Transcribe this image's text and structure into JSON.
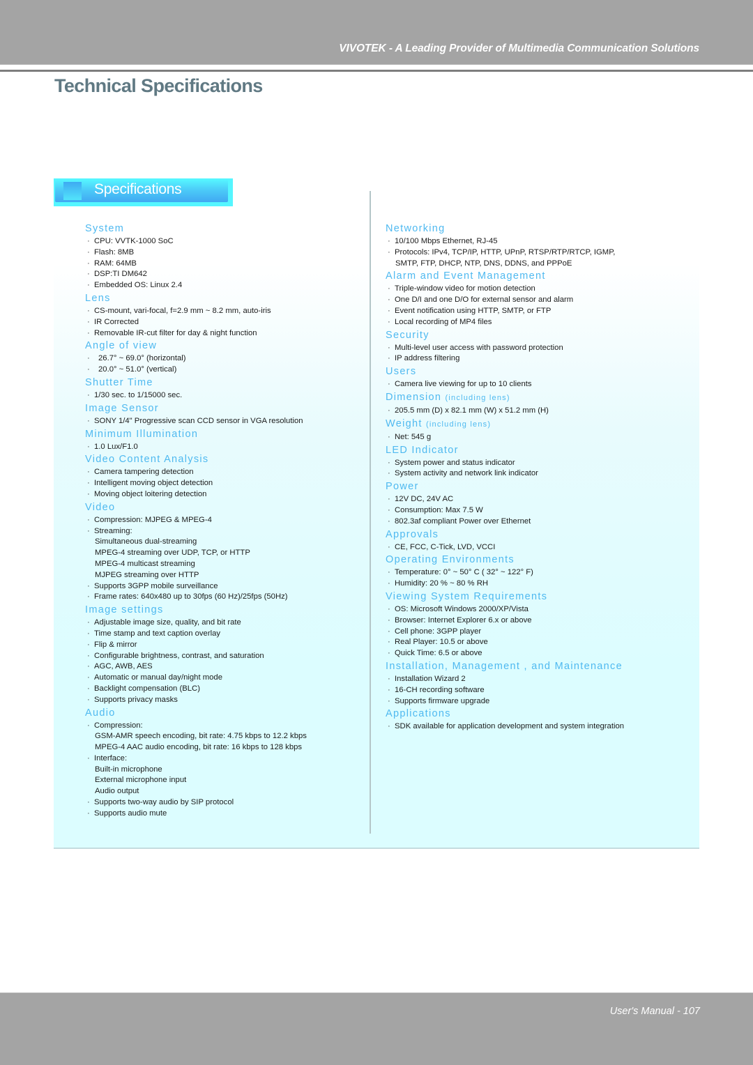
{
  "header": {
    "tagline": "VIVOTEK - A Leading Provider of Multimedia Communication Solutions"
  },
  "page_title": "Technical Specifications",
  "banner": {
    "label": "Specifications"
  },
  "left_column": [
    {
      "title": "System",
      "note": "",
      "items": [
        {
          "text": "CPU: VVTK-1000 SoC",
          "bullet": true
        },
        {
          "text": "Flash: 8MB",
          "bullet": true
        },
        {
          "text": "RAM: 64MB",
          "bullet": true
        },
        {
          "text": "DSP:TI DM642",
          "bullet": true
        },
        {
          "text": "Embedded OS: Linux 2.4",
          "bullet": true
        }
      ]
    },
    {
      "title": "Lens",
      "note": "",
      "items": [
        {
          "text": "CS-mount, vari-focal, f=2.9 mm ~ 8.2 mm, auto-iris",
          "bullet": true
        },
        {
          "text": "IR Corrected",
          "bullet": true
        },
        {
          "text": "Removable IR-cut filter for day & night function",
          "bullet": true
        }
      ]
    },
    {
      "title": "Angle of view",
      "note": "",
      "items": [
        {
          "text": "26.7° ~ 69.0° (horizontal)",
          "bullet": true,
          "wide": true
        },
        {
          "text": "20.0° ~ 51.0° (vertical)",
          "bullet": true,
          "wide": true
        }
      ]
    },
    {
      "title": "Shutter Time",
      "note": "",
      "items": [
        {
          "text": "1/30 sec. to 1/15000 sec.",
          "bullet": true
        }
      ]
    },
    {
      "title": "Image Sensor",
      "note": "",
      "items": [
        {
          "text": "SONY 1/4\" Progressive scan CCD sensor in VGA resolution",
          "bullet": true
        }
      ]
    },
    {
      "title": "Minimum Illumination",
      "note": "",
      "items": [
        {
          "text": "1.0 Lux/F1.0",
          "bullet": true
        }
      ]
    },
    {
      "title": "Video Content Analysis",
      "note": "",
      "items": [
        {
          "text": "Camera tampering detection",
          "bullet": true
        },
        {
          "text": "Intelligent moving object detection",
          "bullet": true
        },
        {
          "text": "Moving object loitering detection",
          "bullet": true
        }
      ]
    },
    {
      "title": "Video",
      "note": "",
      "items": [
        {
          "text": "Compression: MJPEG & MPEG-4",
          "bullet": true
        },
        {
          "text": "Streaming:",
          "bullet": true
        },
        {
          "text": "Simultaneous dual-streaming",
          "bullet": false
        },
        {
          "text": "MPEG-4 streaming over UDP, TCP, or HTTP",
          "bullet": false
        },
        {
          "text": "MPEG-4 multicast streaming",
          "bullet": false
        },
        {
          "text": "MJPEG streaming over HTTP",
          "bullet": false
        },
        {
          "text": "Supports 3GPP mobile surveillance",
          "bullet": true
        },
        {
          "text": "Frame rates: 640x480 up to 30fps (60 Hz)/25fps (50Hz)",
          "bullet": true
        }
      ]
    },
    {
      "title": "Image settings",
      "note": "",
      "items": [
        {
          "text": "Adjustable image size, quality, and bit rate",
          "bullet": true
        },
        {
          "text": "Time stamp and text caption overlay",
          "bullet": true
        },
        {
          "text": "Flip & mirror",
          "bullet": true
        },
        {
          "text": "Configurable brightness, contrast, and saturation",
          "bullet": true
        },
        {
          "text": "AGC, AWB, AES",
          "bullet": true
        },
        {
          "text": "Automatic or manual day/night mode",
          "bullet": true
        },
        {
          "text": "Backlight compensation (BLC)",
          "bullet": true
        },
        {
          "text": "Supports privacy masks",
          "bullet": true
        }
      ]
    },
    {
      "title": "Audio",
      "note": "",
      "items": [
        {
          "text": "Compression:",
          "bullet": true
        },
        {
          "text": "GSM-AMR speech encoding, bit rate: 4.75 kbps to 12.2 kbps",
          "bullet": false
        },
        {
          "text": "MPEG-4 AAC audio encoding, bit rate: 16 kbps to 128 kbps",
          "bullet": false
        },
        {
          "text": "Interface:",
          "bullet": true
        },
        {
          "text": "Built-in microphone",
          "bullet": false
        },
        {
          "text": "External microphone input",
          "bullet": false
        },
        {
          "text": "Audio output",
          "bullet": false
        },
        {
          "text": "Supports two-way audio by SIP protocol",
          "bullet": true
        },
        {
          "text": "Supports audio mute",
          "bullet": true
        }
      ]
    }
  ],
  "right_column": [
    {
      "title": "Networking",
      "note": "",
      "items": [
        {
          "text": "10/100 Mbps Ethernet, RJ-45",
          "bullet": true
        },
        {
          "text": "Protocols: IPv4, TCP/IP, HTTP, UPnP, RTSP/RTP/RTCP, IGMP,",
          "bullet": true
        },
        {
          "text": "SMTP, FTP, DHCP, NTP, DNS, DDNS, and PPPoE",
          "bullet": false
        }
      ]
    },
    {
      "title": "Alarm and Event Management",
      "note": "",
      "items": [
        {
          "text": "Triple-window video for motion detection",
          "bullet": true
        },
        {
          "text": "One D/I and one D/O for external sensor and alarm",
          "bullet": true
        },
        {
          "text": "Event notification using HTTP, SMTP, or FTP",
          "bullet": true
        },
        {
          "text": "Local recording of MP4 files",
          "bullet": true
        }
      ]
    },
    {
      "title": "Security",
      "note": "",
      "items": [
        {
          "text": "Multi-level user access with password protection",
          "bullet": true
        },
        {
          "text": "IP address filtering",
          "bullet": true
        }
      ]
    },
    {
      "title": "Users",
      "note": "",
      "items": [
        {
          "text": "Camera live viewing for up to 10 clients",
          "bullet": true
        }
      ]
    },
    {
      "title": "Dimension",
      "note": "(including lens)",
      "items": [
        {
          "text": "205.5 mm (D) x 82.1 mm (W) x 51.2 mm (H)",
          "bullet": true
        }
      ]
    },
    {
      "title": "Weight",
      "note": "(including lens)",
      "items": [
        {
          "text": "Net: 545 g",
          "bullet": true
        }
      ]
    },
    {
      "title": "LED Indicator",
      "note": "",
      "items": [
        {
          "text": "System power and status indicator",
          "bullet": true
        },
        {
          "text": "System activity and network link indicator",
          "bullet": true
        }
      ]
    },
    {
      "title": "Power",
      "note": "",
      "items": [
        {
          "text": "12V DC, 24V AC",
          "bullet": true
        },
        {
          "text": "Consumption: Max 7.5 W",
          "bullet": true
        },
        {
          "text": "802.3af compliant Power over Ethernet",
          "bullet": true
        }
      ]
    },
    {
      "title": "Approvals",
      "note": "",
      "items": [
        {
          "text": "CE, FCC, C-Tick, LVD, VCCI",
          "bullet": true
        }
      ]
    },
    {
      "title": "Operating Environments",
      "note": "",
      "items": [
        {
          "text": "Temperature: 0° ~ 50° C ( 32° ~ 122° F)",
          "bullet": true
        },
        {
          "text": "Humidity: 20 % ~ 80 % RH",
          "bullet": true
        }
      ]
    },
    {
      "title": "Viewing System Requirements",
      "note": "",
      "items": [
        {
          "text": "OS: Microsoft Windows 2000/XP/Vista",
          "bullet": true
        },
        {
          "text": "Browser: Internet Explorer 6.x or above",
          "bullet": true
        },
        {
          "text": "Cell phone: 3GPP player",
          "bullet": true
        },
        {
          "text": "Real Player: 10.5 or above",
          "bullet": true
        },
        {
          "text": "Quick Time: 6.5 or above",
          "bullet": true
        }
      ]
    },
    {
      "title": "Installation, Management , and Maintenance",
      "note": "",
      "items": [
        {
          "text": "Installation Wizard 2",
          "bullet": true
        },
        {
          "text": "16-CH recording software",
          "bullet": true
        },
        {
          "text": "Supports firmware upgrade",
          "bullet": true
        }
      ]
    },
    {
      "title": "Applications",
      "note": "",
      "items": [
        {
          "text": "SDK available for application development and system integration",
          "bullet": true
        }
      ]
    }
  ],
  "footer": {
    "text": "User's Manual - 107"
  },
  "colors": {
    "header_band": "#a4a4a4",
    "title": "#607983",
    "section_heading": "#4fb9f0",
    "banner": "#40a8f2",
    "panel_bg": "#dcfdff"
  }
}
